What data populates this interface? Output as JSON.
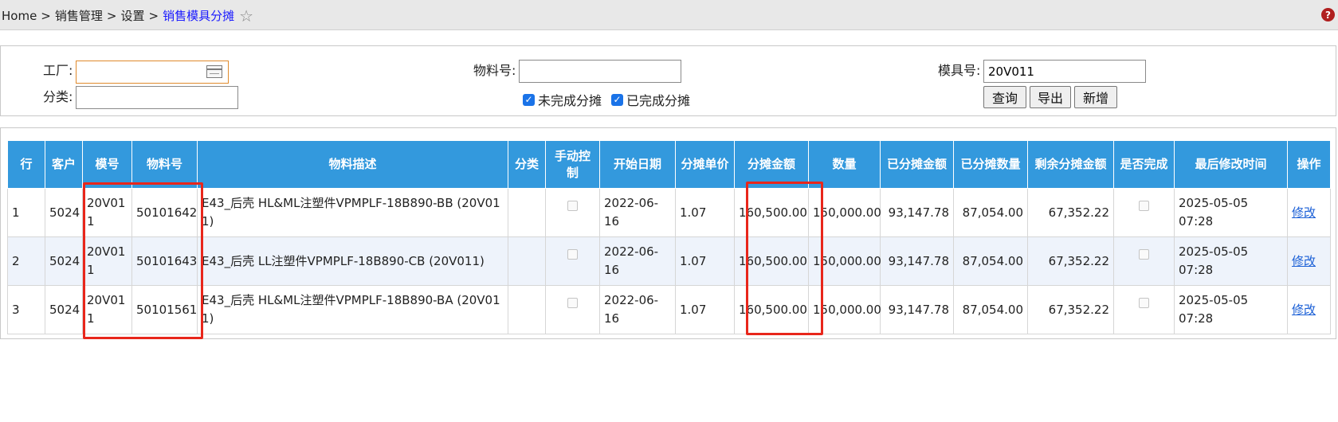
{
  "breadcrumb": {
    "items": [
      "Home",
      "销售管理",
      "设置"
    ],
    "separator": ">",
    "current": "销售模具分摊"
  },
  "icons": {
    "favorite": "star-outline-icon",
    "help": "help-icon",
    "help_glyph": "?"
  },
  "filters": {
    "factory_label": "工厂:",
    "factory_value": "",
    "category_label": "分类:",
    "category_value": "",
    "material_label": "物料号:",
    "material_value": "",
    "unfinished_label": "未完成分摊",
    "finished_label": "已完成分摊",
    "mold_label": "模具号:",
    "mold_value": "20V011",
    "query_button": "查询",
    "export_button": "导出",
    "add_button": "新增"
  },
  "table": {
    "headers": [
      "行",
      "客户",
      "模号",
      "物料号",
      "物料描述",
      "分类",
      "手动控制",
      "开始日期",
      "分摊单价",
      "分摊金额",
      "数量",
      "已分摊金额",
      "已分摊数量",
      "剩余分摊金额",
      "是否完成",
      "最后修改时间",
      "操作"
    ],
    "rows": [
      {
        "row": "1",
        "customer": "5024",
        "mold": "20V011",
        "material": "50101642",
        "desc": "E43_后壳 HL&ML注塑件VPMPLF-18B890-BB (20V011)",
        "category": "",
        "start_date": "2022-06-16",
        "unit_price": "1.07",
        "amount": "160,500.00",
        "qty": "150,000.00",
        "allocated_amount": "93,147.78",
        "allocated_qty": "87,054.00",
        "remaining_amount": "67,352.22",
        "last_modified": "2025-05-05 07:28",
        "action": "修改"
      },
      {
        "row": "2",
        "customer": "5024",
        "mold": "20V011",
        "material": "50101643",
        "desc": "E43_后壳 LL注塑件VPMPLF-18B890-CB (20V011)",
        "category": "",
        "start_date": "2022-06-16",
        "unit_price": "1.07",
        "amount": "160,500.00",
        "qty": "150,000.00",
        "allocated_amount": "93,147.78",
        "allocated_qty": "87,054.00",
        "remaining_amount": "67,352.22",
        "last_modified": "2025-05-05 07:28",
        "action": "修改"
      },
      {
        "row": "3",
        "customer": "5024",
        "mold": "20V011",
        "material": "50101561",
        "desc": "E43_后壳 HL&ML注塑件VPMPLF-18B890-BA (20V011)",
        "category": "",
        "start_date": "2022-06-16",
        "unit_price": "1.07",
        "amount": "160,500.00",
        "qty": "150,000.00",
        "allocated_amount": "93,147.78",
        "allocated_qty": "87,054.00",
        "remaining_amount": "67,352.22",
        "last_modified": "2025-05-05 07:28",
        "action": "修改"
      }
    ]
  },
  "colors": {
    "header_bg": "#3399dd",
    "highlight": "#e8261b",
    "link": "#1a5fd6",
    "current_crumb": "#1a1aff"
  }
}
